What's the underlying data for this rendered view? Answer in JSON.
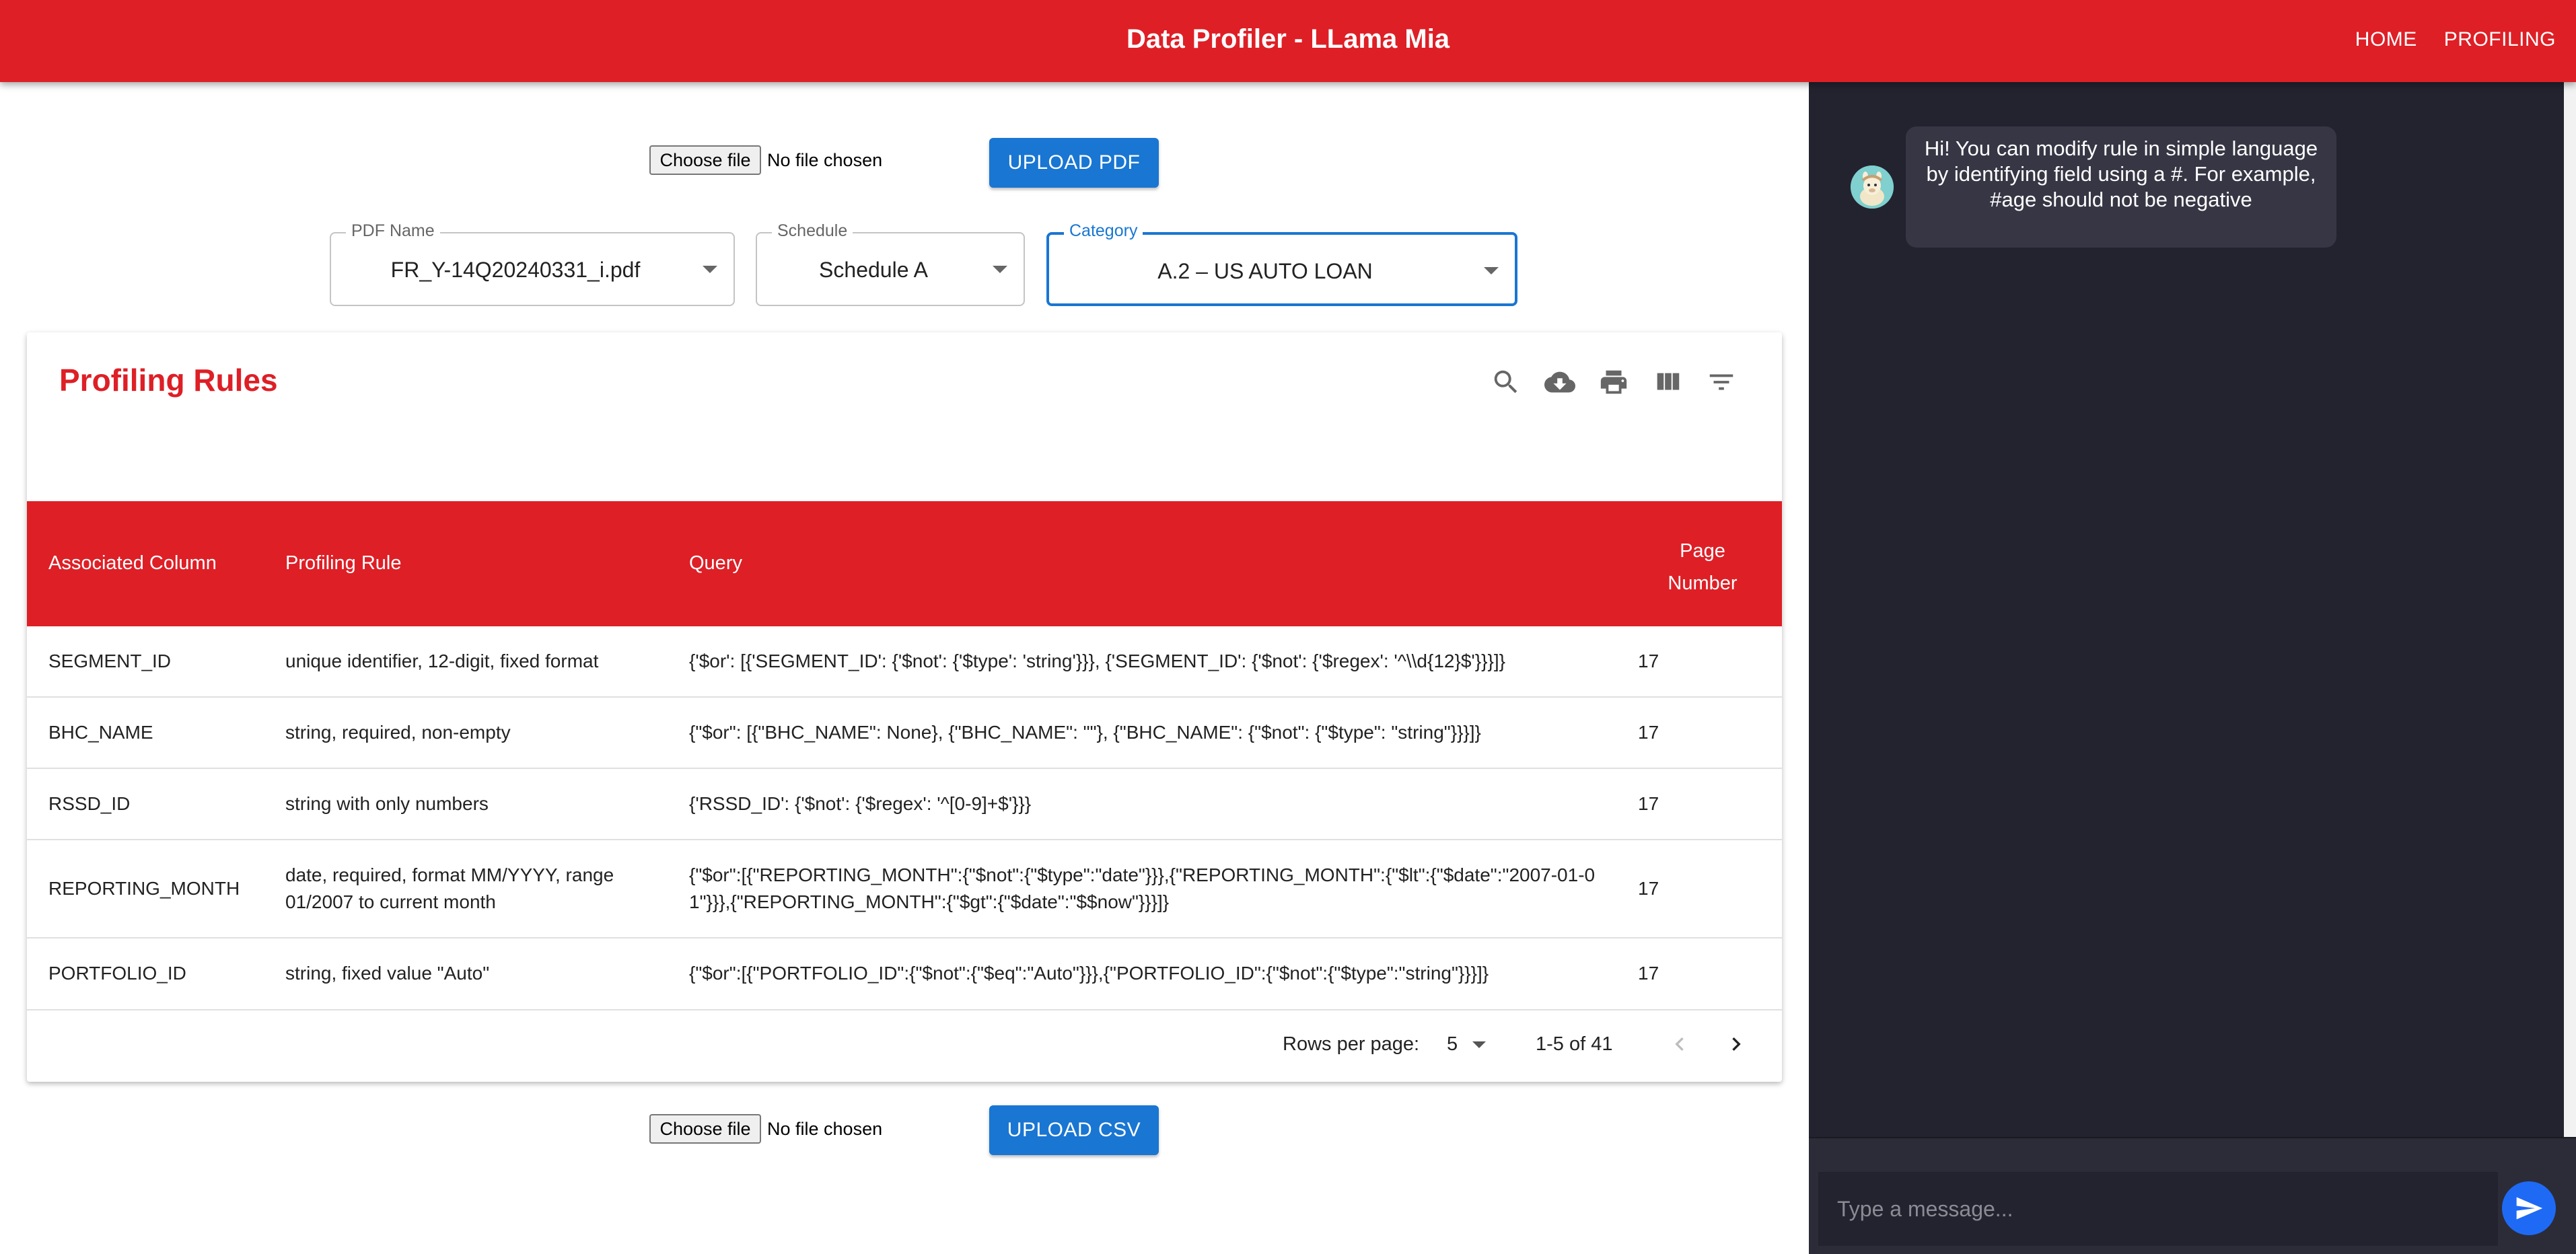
{
  "app": {
    "title": "Data Profiler - LLama Mia",
    "nav": [
      "HOME",
      "PROFILING"
    ]
  },
  "pdf_upload": {
    "choose_file": "Choose file",
    "status": "No file chosen",
    "button": "UPLOAD PDF"
  },
  "filters": {
    "pdf_name": {
      "label": "PDF Name",
      "value": "FR_Y-14Q20240331_i.pdf"
    },
    "schedule": {
      "label": "Schedule",
      "value": "Schedule A"
    },
    "category": {
      "label": "Category",
      "value": "A.2 – US AUTO LOAN"
    }
  },
  "table": {
    "title": "Profiling Rules",
    "toolbar_icons": [
      "search-icon",
      "download-icon",
      "print-icon",
      "columns-icon",
      "filter-icon"
    ],
    "columns": [
      "Associated Column",
      "Profiling Rule",
      "Query",
      "Page Number"
    ],
    "rows": [
      {
        "column": "SEGMENT_ID",
        "rule": "unique identifier, 12-digit, fixed format",
        "query": "{'$or': [{'SEGMENT_ID': {'$not': {'$type': 'string'}}}, {'SEGMENT_ID': {'$not': {'$regex': '^\\\\d{12}$'}}}]}",
        "page": "17"
      },
      {
        "column": "BHC_NAME",
        "rule": "string, required, non-empty",
        "query": "{\"$or\": [{\"BHC_NAME\": None}, {\"BHC_NAME\": \"\"}, {\"BHC_NAME\": {\"$not\": {\"$type\": \"string\"}}}]}",
        "page": "17"
      },
      {
        "column": "RSSD_ID",
        "rule": "string with only numbers",
        "query": "{'RSSD_ID': {'$not': {'$regex': '^[0-9]+$'}}}",
        "page": "17"
      },
      {
        "column": "REPORTING_MONTH",
        "rule": "date, required, format MM/YYYY, range 01/2007 to current month",
        "query": "{\"$or\":[{\"REPORTING_MONTH\":{\"$not\":{\"$type\":\"date\"}}},{\"REPORTING_MONTH\":{\"$lt\":{\"$date\":\"2007-01-01\"}}},{\"REPORTING_MONTH\":{\"$gt\":{\"$date\":\"$$now\"}}}]}",
        "page": "17"
      },
      {
        "column": "PORTFOLIO_ID",
        "rule": "string, fixed value \"Auto\"",
        "query": "{\"$or\":[{\"PORTFOLIO_ID\":{\"$not\":{\"$eq\":\"Auto\"}}},{\"PORTFOLIO_ID\":{\"$not\":{\"$type\":\"string\"}}}]}",
        "page": "17"
      }
    ],
    "footer": {
      "rows_per_page_label": "Rows per page:",
      "rows_per_page_value": "5",
      "range": "1-5 of 41"
    }
  },
  "csv_upload": {
    "choose_file": "Choose file",
    "status": "No file chosen",
    "button": "UPLOAD CSV"
  },
  "chat": {
    "message": "Hi! You can modify rule in simple language by identifying field using a #. For example, #age should not be negative",
    "input_placeholder": "Type a message..."
  },
  "colors": {
    "brand": "#de1f26",
    "primary": "#1976d2",
    "chat_bg": "#23232f"
  }
}
